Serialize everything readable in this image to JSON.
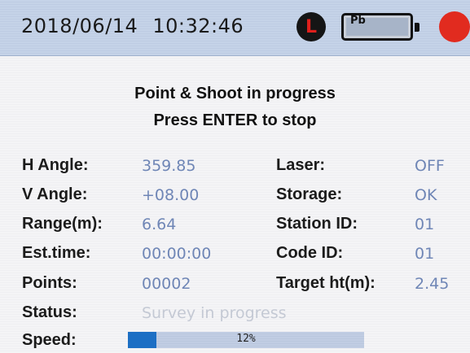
{
  "status_bar": {
    "date": "2018/06/14",
    "time": "10:32:46",
    "laser_icon_glyph": "L",
    "battery_label": "Pb",
    "icons": [
      "laser-icon",
      "battery-icon",
      "record-icon"
    ]
  },
  "heading": {
    "line1": "Point & Shoot in progress",
    "line2": "Press ENTER to stop"
  },
  "fields": {
    "h_angle": {
      "label": "H Angle:",
      "value": "359.85"
    },
    "v_angle": {
      "label": "V Angle:",
      "value": "+08.00"
    },
    "range": {
      "label": "Range(m):",
      "value": "6.64"
    },
    "est_time": {
      "label": "Est.time:",
      "value": "00:00:00"
    },
    "points": {
      "label": "Points:",
      "value": "00002"
    },
    "laser": {
      "label": "Laser:",
      "value": "OFF"
    },
    "storage": {
      "label": "Storage:",
      "value": "OK"
    },
    "station_id": {
      "label": "Station ID:",
      "value": "01"
    },
    "code_id": {
      "label": "Code ID:",
      "value": "01"
    },
    "target_ht": {
      "label": "Target ht(m):",
      "value": "2.45"
    },
    "status": {
      "label": "Status:",
      "value": "Survey in progress"
    },
    "speed": {
      "label": "Speed:",
      "value_text": "12%",
      "fraction": 0.12
    }
  },
  "colors": {
    "value_text": "#6f86b6",
    "status_text": "#c4c9d4",
    "progress_fill": "#1d6fc4",
    "record": "#e12b1f"
  }
}
